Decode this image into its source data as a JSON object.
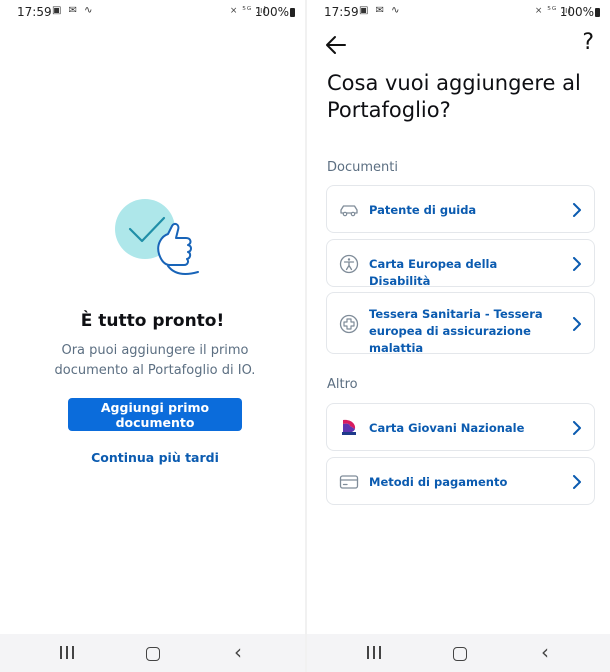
{
  "left_screen": {
    "statusbar": {
      "time": "17:59",
      "icons": "▣ ✉ ∿",
      "signal": "⨯ ⁵ᴳ .ıl",
      "battery": "100%"
    },
    "title": "È tutto pronto!",
    "body": "Ora puoi aggiungere il primo documento al Portafoglio di IO.",
    "primary_button": "Aggiungi primo documento",
    "secondary_button": "Continua più tardi",
    "illustration": "check-thumbs-up-illustration"
  },
  "right_screen": {
    "statusbar": {
      "time": "17:59",
      "icons": "▣ ✉ ∿",
      "signal": "⨯ ⁵ᴳ .ıl",
      "battery": "100%"
    },
    "back_icon": "arrow-left-icon",
    "help_label": "?",
    "title": "Cosa vuoi aggiungere al Portafoglio?",
    "sections": [
      {
        "title": "Documenti",
        "items": [
          {
            "label": "Patente di guida",
            "icon": "car-icon"
          },
          {
            "label": "Carta Europea della Disabilità",
            "icon": "accessibility-icon"
          },
          {
            "label": "Tessera Sanitaria - Tessera europea di assicurazione malattia",
            "icon": "health-card-icon"
          }
        ]
      },
      {
        "title": "Altro",
        "items": [
          {
            "label": "Carta Giovani Nazionale",
            "icon": "carta-giovani-logo"
          },
          {
            "label": "Metodi di pagamento",
            "icon": "credit-card-icon"
          }
        ]
      }
    ]
  },
  "colors": {
    "primary": "#0b6cdb",
    "link": "#0b5bb0",
    "muted_text": "#5c6f82",
    "illustration_teal": "#aee7ea",
    "navbar_bg": "#f4f4f6"
  }
}
